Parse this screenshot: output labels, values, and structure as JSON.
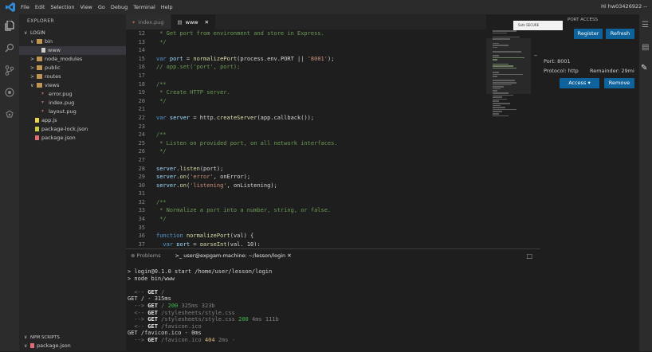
{
  "titlebar": {
    "menus": [
      "File",
      "Edit",
      "Selection",
      "View",
      "Go",
      "Debug",
      "Terminal",
      "Help"
    ],
    "user": "Hi hw03426922 --"
  },
  "sidebar": {
    "title": "EXPLORER",
    "folder": "LOGIN",
    "items": [
      {
        "label": "bin",
        "level": 1,
        "type": "folder-open",
        "arrow": "∨"
      },
      {
        "label": "www",
        "level": 2,
        "type": "file",
        "selected": true
      },
      {
        "label": "node_modules",
        "level": 1,
        "type": "folder",
        "arrow": ">"
      },
      {
        "label": "public",
        "level": 1,
        "type": "folder",
        "arrow": ">"
      },
      {
        "label": "routes",
        "level": 1,
        "type": "folder",
        "arrow": ">"
      },
      {
        "label": "views",
        "level": 1,
        "type": "folder-open",
        "arrow": "∨"
      },
      {
        "label": "error.pug",
        "level": 2,
        "type": "pug"
      },
      {
        "label": "index.pug",
        "level": 2,
        "type": "pug"
      },
      {
        "label": "layout.pug",
        "level": 2,
        "type": "pug"
      },
      {
        "label": "app.js",
        "level": 1,
        "type": "js"
      },
      {
        "label": "package-lock.json",
        "level": 1,
        "type": "json"
      },
      {
        "label": "package.json",
        "level": 1,
        "type": "json-red"
      }
    ],
    "npm_title": "NPM SCRIPTS",
    "npm_item": "package.json"
  },
  "tabs": [
    {
      "label": "index.pug",
      "active": false
    },
    {
      "label": "www",
      "active": true
    }
  ],
  "editor": {
    "lines": [
      {
        "n": "12",
        "segs": [
          [
            " * Get port from environment and store in Express.",
            "c-com"
          ]
        ]
      },
      {
        "n": "13",
        "segs": [
          [
            " */",
            "c-com"
          ]
        ]
      },
      {
        "n": "14",
        "segs": [
          [
            "",
            ""
          ]
        ]
      },
      {
        "n": "15",
        "segs": [
          [
            "var ",
            "c-kw"
          ],
          [
            "port",
            "c-var"
          ],
          [
            " = ",
            ""
          ],
          [
            "normalizePort",
            "c-fn"
          ],
          [
            "(process.env.PORT || ",
            ""
          ],
          [
            "'8001'",
            "c-str"
          ],
          [
            ");",
            ""
          ]
        ]
      },
      {
        "n": "16",
        "segs": [
          [
            "// app.set('port', port);",
            "c-com"
          ]
        ]
      },
      {
        "n": "17",
        "segs": [
          [
            "",
            ""
          ]
        ]
      },
      {
        "n": "18",
        "segs": [
          [
            "/**",
            "c-com"
          ]
        ]
      },
      {
        "n": "19",
        "segs": [
          [
            " * Create HTTP server.",
            "c-com"
          ]
        ]
      },
      {
        "n": "20",
        "segs": [
          [
            " */",
            "c-com"
          ]
        ]
      },
      {
        "n": "21",
        "segs": [
          [
            "",
            ""
          ]
        ]
      },
      {
        "n": "22",
        "segs": [
          [
            "var ",
            "c-kw"
          ],
          [
            "server",
            "c-var"
          ],
          [
            " = http.",
            ""
          ],
          [
            "createServer",
            "c-fn"
          ],
          [
            "(app.callback());",
            ""
          ]
        ]
      },
      {
        "n": "23",
        "segs": [
          [
            "",
            ""
          ]
        ]
      },
      {
        "n": "24",
        "segs": [
          [
            "/**",
            "c-com"
          ]
        ]
      },
      {
        "n": "25",
        "segs": [
          [
            " * Listen on provided port, on all network interfaces.",
            "c-com"
          ]
        ]
      },
      {
        "n": "26",
        "segs": [
          [
            " */",
            "c-com"
          ]
        ]
      },
      {
        "n": "27",
        "segs": [
          [
            "",
            ""
          ]
        ]
      },
      {
        "n": "28",
        "segs": [
          [
            "server",
            "c-var"
          ],
          [
            ".",
            ""
          ],
          [
            "listen",
            "c-fn"
          ],
          [
            "(port);",
            ""
          ]
        ]
      },
      {
        "n": "29",
        "segs": [
          [
            "server",
            "c-var"
          ],
          [
            ".",
            ""
          ],
          [
            "on",
            "c-fn"
          ],
          [
            "(",
            ""
          ],
          [
            "'error'",
            "c-str"
          ],
          [
            ", onError);",
            ""
          ]
        ]
      },
      {
        "n": "30",
        "segs": [
          [
            "server",
            "c-var"
          ],
          [
            ".",
            ""
          ],
          [
            "on",
            "c-fn"
          ],
          [
            "(",
            ""
          ],
          [
            "'listening'",
            "c-str"
          ],
          [
            ", onListening);",
            ""
          ]
        ]
      },
      {
        "n": "31",
        "segs": [
          [
            "",
            ""
          ]
        ]
      },
      {
        "n": "32",
        "segs": [
          [
            "/**",
            "c-com"
          ]
        ]
      },
      {
        "n": "33",
        "segs": [
          [
            " * Normalize a port into a number, string, or false.",
            "c-com"
          ]
        ]
      },
      {
        "n": "34",
        "segs": [
          [
            " */",
            "c-com"
          ]
        ]
      },
      {
        "n": "35",
        "segs": [
          [
            "",
            ""
          ]
        ]
      },
      {
        "n": "36",
        "segs": [
          [
            "function ",
            "c-kw"
          ],
          [
            "normalizePort",
            "c-fn"
          ],
          [
            "(val) {",
            ""
          ]
        ]
      },
      {
        "n": "37",
        "segs": [
          [
            "  var ",
            "c-kw"
          ],
          [
            "port",
            "c-var"
          ],
          [
            " = ",
            ""
          ],
          [
            "parseInt",
            "c-fn"
          ],
          [
            "(val, 10);",
            ""
          ]
        ]
      }
    ]
  },
  "rightpanel": {
    "title": "PORT ACCESS",
    "thumb_text": "Safe SECURE",
    "register": "Register",
    "refresh": "Refresh",
    "port": "Port: 8001",
    "protocol": "Protocol: http",
    "remainder": "Remainder: 29mi",
    "access": "Access",
    "remove": "Remove"
  },
  "panel": {
    "tab_problems": "Problems",
    "tab_terminal": "user@expgam-machine: ~/lesson/login",
    "terminal_lines": [
      {
        "text": "> login@0.1.0 start /home/user/lesson/login",
        "cls": ""
      },
      {
        "text": "> node bin/www",
        "cls": ""
      },
      {
        "text": "",
        "cls": ""
      },
      {
        "segs": [
          [
            "  <-- ",
            "t-dim"
          ],
          [
            "GET",
            "t-bold"
          ],
          [
            " /",
            "t-dim"
          ]
        ]
      },
      {
        "text": "GET / - 315ms",
        "cls": ""
      },
      {
        "segs": [
          [
            "  --> ",
            "t-dim"
          ],
          [
            "GET",
            "t-bold"
          ],
          [
            " / ",
            "t-dim"
          ],
          [
            "200",
            "t-green"
          ],
          [
            " 325ms 323b",
            "t-dim"
          ]
        ]
      },
      {
        "segs": [
          [
            "  <-- ",
            "t-dim"
          ],
          [
            "GET",
            "t-bold"
          ],
          [
            " /stylesheets/style.css",
            "t-dim"
          ]
        ]
      },
      {
        "segs": [
          [
            "  --> ",
            "t-dim"
          ],
          [
            "GET",
            "t-bold"
          ],
          [
            " /stylesheets/style.css ",
            "t-dim"
          ],
          [
            "200",
            "t-green"
          ],
          [
            " 4ms 111b",
            "t-dim"
          ]
        ]
      },
      {
        "segs": [
          [
            "  <-- ",
            "t-dim"
          ],
          [
            "GET",
            "t-bold"
          ],
          [
            " /favicon.ico",
            "t-dim"
          ]
        ]
      },
      {
        "text": "GET /favicon.ico - 0ms",
        "cls": ""
      },
      {
        "segs": [
          [
            "  --> ",
            "t-dim"
          ],
          [
            "GET",
            "t-bold"
          ],
          [
            " /favicon.ico ",
            "t-dim"
          ],
          [
            "404",
            "t-yellow"
          ],
          [
            " 2ms -",
            "t-dim"
          ]
        ]
      }
    ]
  },
  "colors": {
    "accent": "#0e639c",
    "folder": "#c09553",
    "js": "#e8d44d",
    "pug": "#a86454",
    "json": "#cbcb41",
    "json_red": "#e06c75"
  }
}
